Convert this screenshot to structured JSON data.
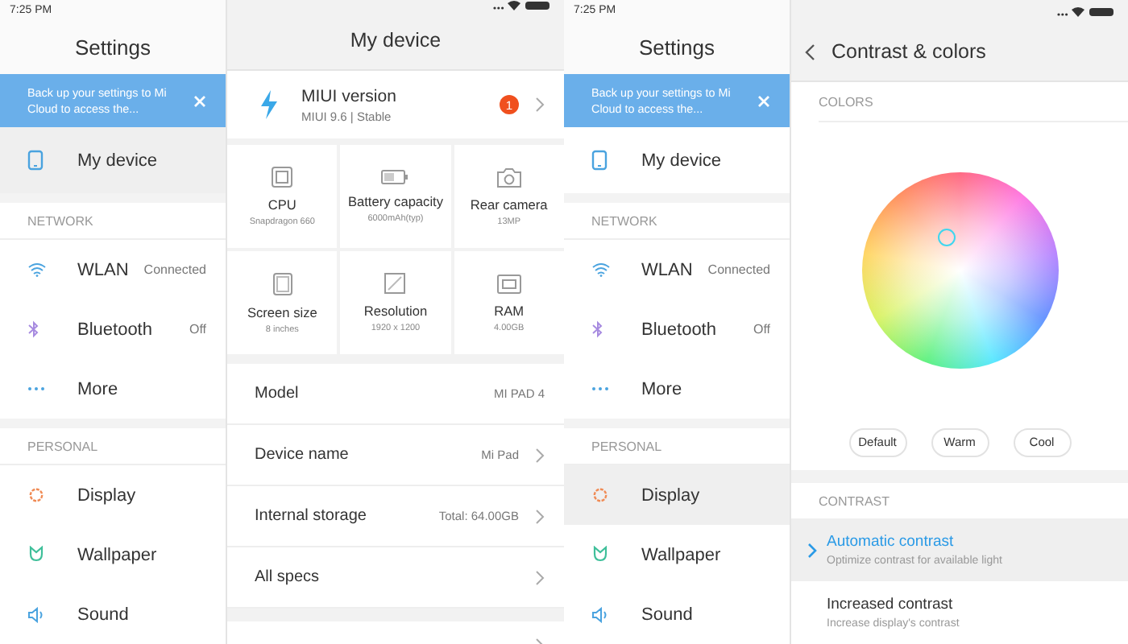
{
  "screens": [
    {
      "status_bar": {
        "time": "7:25 PM"
      },
      "sidebar": {
        "title": "Settings",
        "banner": "Back up your settings to Mi Cloud to access the...",
        "sections": [
          {
            "items": [
              {
                "label": "My device",
                "selected": true
              }
            ]
          },
          {
            "header": "NETWORK",
            "items": [
              {
                "label": "WLAN",
                "value": "Connected",
                "selected": false
              },
              {
                "label": "Bluetooth",
                "value": "Off",
                "selected": false
              },
              {
                "label": "More",
                "selected": false
              }
            ]
          },
          {
            "header": "PERSONAL",
            "items": [
              {
                "label": "Display",
                "selected": false
              },
              {
                "label": "Wallpaper",
                "selected": false
              },
              {
                "label": "Sound",
                "selected": false
              }
            ]
          }
        ]
      },
      "detail": {
        "kind": "device",
        "title": "My device",
        "version": {
          "title": "MIUI version",
          "subtitle": "MIUI 9.6 | Stable",
          "badge": "1"
        },
        "specs": [
          {
            "label": "CPU",
            "value": "Snapdragon 660"
          },
          {
            "label": "Battery capacity",
            "value": "6000mAh(typ)"
          },
          {
            "label": "Rear camera",
            "value": "13MP"
          },
          {
            "label": "Screen size",
            "value": "8 inches"
          },
          {
            "label": "Resolution",
            "value": "1920 x 1200"
          },
          {
            "label": "RAM",
            "value": "4.00GB"
          }
        ],
        "rows": [
          {
            "label": "Model",
            "value": "MI PAD 4",
            "chevron": false
          },
          {
            "label": "Device name",
            "value": "Mi Pad",
            "chevron": true
          },
          {
            "label": "Internal storage",
            "value": "Total: 64.00GB",
            "chevron": true
          },
          {
            "label": "All specs",
            "chevron": true
          }
        ]
      }
    },
    {
      "status_bar": {
        "time": "7:25 PM"
      },
      "sidebar": {
        "title": "Settings",
        "banner": "Back up your settings to Mi Cloud to access the...",
        "sections": [
          {
            "items": [
              {
                "label": "My device",
                "selected": false
              }
            ]
          },
          {
            "header": "NETWORK",
            "items": [
              {
                "label": "WLAN",
                "value": "Connected",
                "selected": false
              },
              {
                "label": "Bluetooth",
                "value": "Off",
                "selected": false
              },
              {
                "label": "More",
                "selected": false
              }
            ]
          },
          {
            "header": "PERSONAL",
            "items": [
              {
                "label": "Display",
                "selected": true
              },
              {
                "label": "Wallpaper",
                "selected": false
              },
              {
                "label": "Sound",
                "selected": false
              }
            ]
          }
        ]
      },
      "detail": {
        "kind": "contrast",
        "title": "Contrast & colors",
        "colors_header": "COLORS",
        "presets": [
          "Default",
          "Warm",
          "Cool"
        ],
        "contrast_header": "CONTRAST",
        "options": [
          {
            "title": "Automatic contrast",
            "subtitle": "Optimize contrast for available light",
            "selected": true
          },
          {
            "title": "Increased contrast",
            "subtitle": "Increase display's contrast",
            "selected": false
          }
        ]
      }
    }
  ]
}
